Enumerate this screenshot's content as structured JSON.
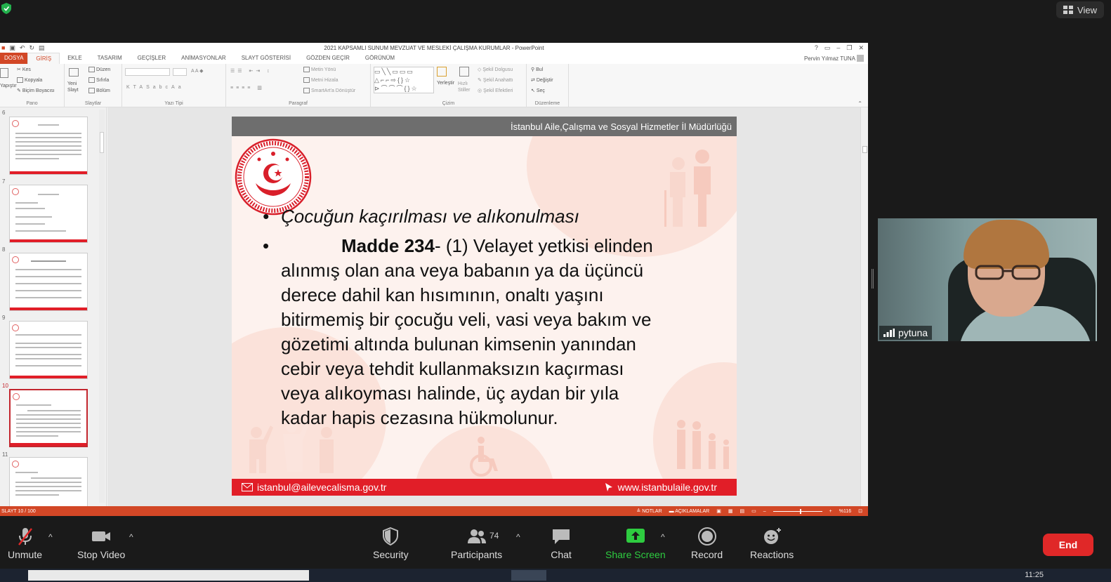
{
  "zoom": {
    "view_label": "View",
    "colors": {
      "end": "#e02828",
      "share": "#2ecc40",
      "ppt_accent": "#d24726",
      "slide_red": "#e11e28"
    },
    "toolbar": {
      "unmute": "Unmute",
      "stop_video": "Stop Video",
      "security": "Security",
      "participants": "Participants",
      "participants_count": "74",
      "chat": "Chat",
      "share_screen": "Share Screen",
      "record": "Record",
      "reactions": "Reactions",
      "end": "End"
    },
    "video": {
      "name": "pytuna"
    },
    "clock": "11:25"
  },
  "ppt": {
    "window_title": "2021 KAPSAMLI SUNUM MEVZUAT VE MESLEKİ ÇALIŞMA KURUMLAR - PowerPoint",
    "user": "Pervin Yılmaz TUNA",
    "tabs": [
      "DOSYA",
      "GİRİŞ",
      "EKLE",
      "TASARIM",
      "GEÇİŞLER",
      "ANİMASYONLAR",
      "SLAYT GÖSTERİSİ",
      "GÖZDEN GEÇİR",
      "GÖRÜNÜM"
    ],
    "ribbon": {
      "pano": {
        "label": "Pano",
        "yapistir": "Yapıştır",
        "kes": "Kes",
        "kopyala": "Kopyala",
        "bicim": "Biçim Boyacısı"
      },
      "slaytlar": {
        "label": "Slaytlar",
        "yeni": "Yeni Slayt",
        "duzen": "Düzen",
        "sifirla": "Sıfırla",
        "bolum": "Bölüm"
      },
      "yazi": {
        "label": "Yazı Tipi"
      },
      "paragraf": {
        "label": "Paragraf",
        "yon": "Metin Yönü",
        "hizala": "Metni Hizala",
        "smartart": "SmartArt'a Dönüştür"
      },
      "cizim": {
        "label": "Çizim",
        "yerlestir": "Yerleştir",
        "hizli": "Hızlı Stiller",
        "dolgu": "Şekil Dolgusu",
        "anahat": "Şekil Anahattı",
        "efekt": "Şekil Efektleri"
      },
      "duzenleme": {
        "label": "Düzenleme",
        "bul": "Bul",
        "degistir": "Değiştir",
        "sec": "Seç"
      }
    },
    "thumbs": [
      "6",
      "7",
      "8",
      "9",
      "10",
      "11"
    ],
    "status": {
      "slide": "SLAYT 10 / 100",
      "notes": "NOTLAR",
      "comments": "AÇIKLAMALAR",
      "zoom": "%116"
    }
  },
  "slide": {
    "header": "İstanbul  Aile,Çalışma ve Sosyal Hizmetler İl Müdürlüğü",
    "bullet1": "Çocuğun kaçırılması ve alıkonulması",
    "madde": "Madde 234",
    "line1": "- (1) Velayet yetkisi elinden",
    "line2": "alınmış olan ana veya babanın ya da üçüncü",
    "line3": "derece dahil kan hısımının, onaltı yaşını",
    "line4": "bitirmemiş bir çocuğu veli, vasi veya bakım ve",
    "line5": "gözetimi altında bulunan kimsenin yanından",
    "line6": "cebir veya tehdit kullanmaksızın kaçırması",
    "line7": "veya alıkoyması halinde, üç aydan bir yıla",
    "line8": "kadar hapis cezasına hükmolunur.",
    "email": "istanbul@ailevecalisma.gov.tr",
    "web": "www.istanbulaile.gov.tr"
  }
}
